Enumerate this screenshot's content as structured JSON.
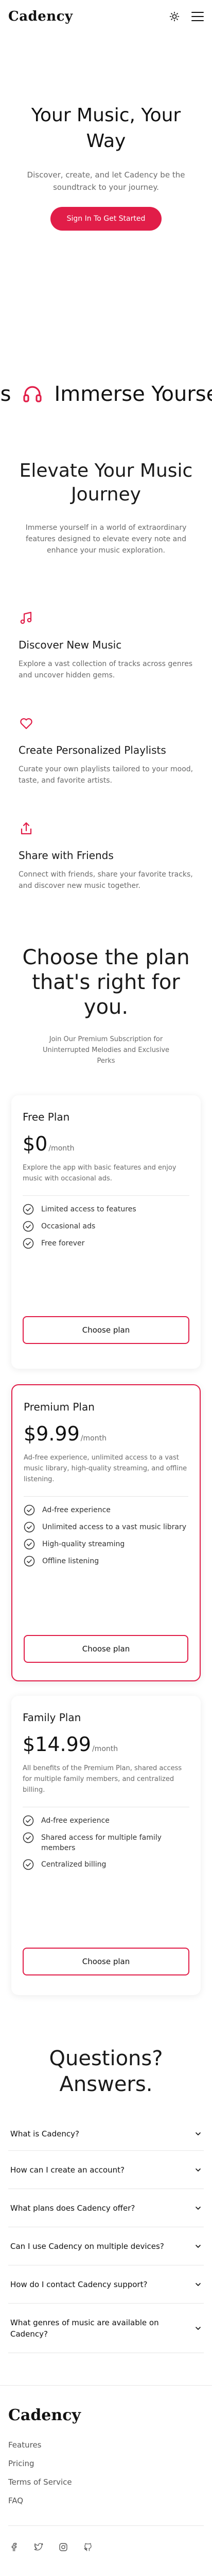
{
  "header": {
    "logo": "Cadency",
    "theme_icon": "sun-icon",
    "menu_icon": "hamburger-menu-icon"
  },
  "hero": {
    "title": "Your Music, Your Way",
    "subtitle": "Discover, create, and let Cadency be the soundtrack to your journey.",
    "cta_label": "Sign In To Get Started"
  },
  "marquee": {
    "left_fragment": "es",
    "right_fragment": "Immerse Yourse",
    "icon": "headphones-icon"
  },
  "features": {
    "title": "Elevate Your Music Journey",
    "intro": "Immerse yourself in a world of extraordinary features designed to elevate every note and enhance your music exploration.",
    "items": [
      {
        "icon": "music-note-icon",
        "title": "Discover New Music",
        "description": "Explore a vast collection of tracks across genres and uncover hidden gems."
      },
      {
        "icon": "heart-icon",
        "title": "Create Personalized Playlists",
        "description": "Curate your own playlists tailored to your mood, taste, and favorite artists."
      },
      {
        "icon": "share-icon",
        "title": "Share with Friends",
        "description": "Connect with friends, share your favorite tracks, and discover new music together."
      }
    ]
  },
  "pricing": {
    "title": "Choose the plan that's right for you.",
    "subtitle": "Join Our Premium Subscription for Uninterrupted Melodies and Exclusive Perks",
    "plans": [
      {
        "name": "Free Plan",
        "price": "$0",
        "period": "/month",
        "description": "Explore the app with basic features and enjoy music with occasional ads.",
        "features": [
          "Limited access to features",
          "Occasional ads",
          "Free forever"
        ],
        "cta": "Choose plan",
        "highlighted": false
      },
      {
        "name": "Premium Plan",
        "price": "$9.99",
        "period": "/month",
        "description": "Ad-free experience, unlimited access to a vast music library, high-quality streaming, and offline listening.",
        "features": [
          "Ad-free experience",
          "Unlimited access to a vast music library",
          "High-quality streaming",
          "Offline listening"
        ],
        "cta": "Choose plan",
        "highlighted": true
      },
      {
        "name": "Family Plan",
        "price": "$14.99",
        "period": "/month",
        "description": "All benefits of the Premium Plan, shared access for multiple family members, and centralized billing.",
        "features": [
          "Ad-free experience",
          "Shared access for multiple family members",
          "Centralized billing"
        ],
        "cta": "Choose plan",
        "highlighted": false
      }
    ]
  },
  "faq": {
    "title": "Questions? Answers.",
    "items": [
      "What is Cadency?",
      "How can I create an account?",
      "What plans does Cadency offer?",
      "Can I use Cadency on multiple devices?",
      "How do I contact Cadency support?",
      "What genres of music are available on Cadency?"
    ]
  },
  "footer": {
    "logo": "Cadency",
    "links": [
      "Features",
      "Pricing",
      "Terms of Service",
      "FAQ"
    ],
    "social_icons": [
      "facebook-icon",
      "twitter-icon",
      "instagram-icon",
      "github-icon"
    ]
  },
  "colors": {
    "accent": "#e11d48",
    "text": "#111111",
    "muted": "#6b6b6b"
  }
}
